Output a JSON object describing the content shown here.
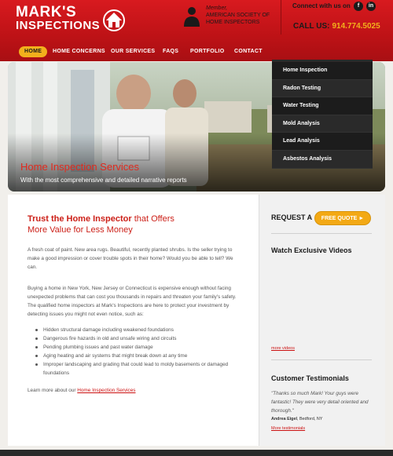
{
  "brand": {
    "line1": "MARK'S",
    "line2": "INSPECTIONS"
  },
  "member": {
    "label": "Member,",
    "org": "AMERICAN SOCIETY OF HOME INSPECTORS"
  },
  "connect": {
    "label": "Connect with us on",
    "facebook": "f",
    "linkedin": "in"
  },
  "call": {
    "label": "CALL US:",
    "number": "914.774.5025"
  },
  "nav": {
    "items": [
      "HOME",
      "HOME CONCERNS",
      "OUR SERVICES",
      "FAQS",
      "PORTFOLIO",
      "CONTACT"
    ]
  },
  "services_menu": [
    "Home Inspection",
    "Radon Testing",
    "Water Testing",
    "Mold Analysis",
    "Lead Analysis",
    "Asbestos Analysis"
  ],
  "hero": {
    "title": "Home Inspection Services",
    "subtitle": "With the most comprehensive and detailed narrative reports"
  },
  "main": {
    "heading_a": "Trust the Home Inspector",
    "heading_b": " that Offers",
    "heading_c": "More Value for Less Money",
    "para1": "A fresh coat of paint. New area rugs. Beautiful, recently planted shrubs. Is the seller trying to make a good impression or cover trouble spots in their home? Would you be able to tell? We can.",
    "para2": "Buying a home in New York, New Jersey or Connecticut is expensive enough without facing unexpected problems that can cost you thousands in repairs and threaten your family's safety. The qualified home inspectors at Mark's Inspections are here to protect your investment by detecting issues you might not even notice, such as:",
    "bullets": [
      "Hidden structural damage including weakened foundations",
      "Dangerous fire hazards in old and unsafe wiring and circuits",
      "Pending plumbing issues and past water damage",
      "Aging heating and air systems that might break down at any time",
      "Improper landscaping and grading that could lead to moldy basements or damaged foundations"
    ],
    "learn_prefix": "Learn more about our",
    "learn_link": "Home Inspection Services"
  },
  "sidebar": {
    "request_label": "REQUEST A",
    "quote_button": "FREE QUOTE",
    "videos_title": "Watch Exclusive Videos",
    "more_videos": "more videos",
    "testimonials_title": "Customer Testimonials",
    "testimonial_text": "\"Thanks so much Mark! Your guys were fantastic! They were very detail oriented and thorough.\"",
    "author_name": "Andrea Eigel",
    "author_location": ", Bedford, NY",
    "more_testimonials": "More testimonials"
  },
  "colors": {
    "brand_red": "#c4161b",
    "accent_gold": "#f2b01c",
    "menu_dark": "#1c1c1c"
  }
}
